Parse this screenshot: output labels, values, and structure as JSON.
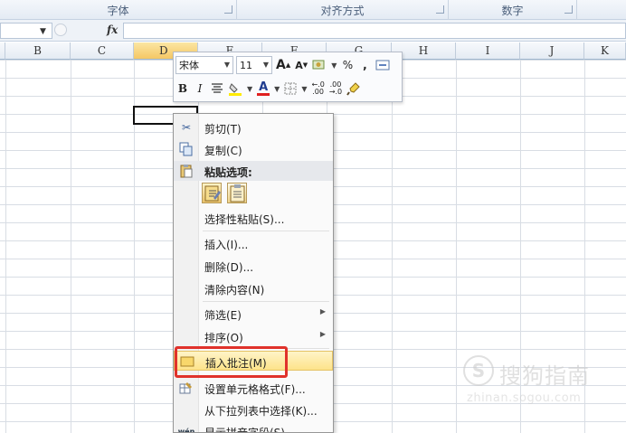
{
  "ribbon": {
    "groups": [
      "字体",
      "对齐方式",
      "数字"
    ]
  },
  "formula_bar": {
    "name_box": "",
    "fx_label": "fx",
    "formula": ""
  },
  "columns": [
    "B",
    "C",
    "D",
    "E",
    "F",
    "G",
    "H",
    "I",
    "J",
    "K"
  ],
  "selected_cell": "D",
  "mini_toolbar": {
    "font_name": "宋体",
    "font_size": "11",
    "grow_font": "A",
    "shrink_font": "A",
    "percent": "%",
    "comma": ",",
    "bold": "B",
    "italic": "I",
    "font_color_letter": "A",
    "inc_decimal": "+.0 .00",
    "dec_decimal": ".00 +.0"
  },
  "context_menu": {
    "cut": "剪切(T)",
    "copy": "复制(C)",
    "paste_options": "粘贴选项:",
    "paste_special": "选择性粘贴(S)...",
    "insert": "插入(I)...",
    "delete": "删除(D)...",
    "clear": "清除内容(N)",
    "filter": "筛选(E)",
    "sort": "排序(O)",
    "insert_comment": "插入批注(M)",
    "format_cells": "设置单元格格式(F)...",
    "pick_list": "从下拉列表中选择(K)...",
    "phonetic": "显示拼音字段(S)"
  },
  "watermark": {
    "brand": "搜狗指南",
    "url": "zhinan.sogou.com",
    "glyph": "S"
  },
  "colors": {
    "highlight_border": "#e0322b",
    "menu_hover": "#fde38a",
    "active_header": "#f5c764"
  }
}
